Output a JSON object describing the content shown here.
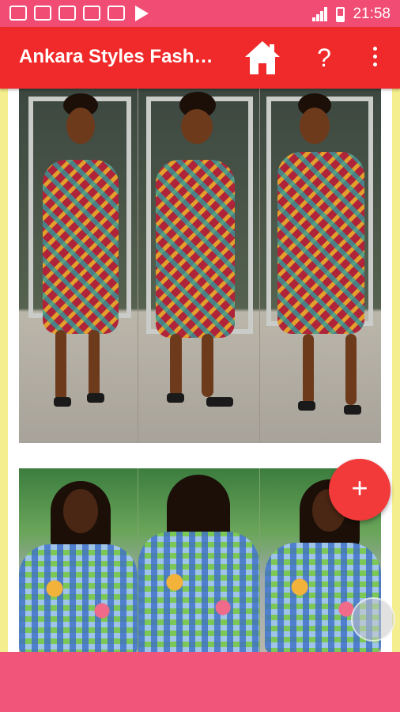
{
  "status_bar": {
    "time": "21:58",
    "notification_icons": [
      "message-icon",
      "image-icon",
      "chat-icon",
      "office-icon",
      "check-icon",
      "play-store-icon"
    ]
  },
  "app_bar": {
    "title": "Ankara Styles Fashion",
    "home_icon": "home-icon",
    "help_label": "?",
    "more_icon": "more-vert-icon"
  },
  "fab": {
    "label": "+"
  },
  "colors": {
    "status_bar": "#f04c74",
    "app_bar": "#f02a2a",
    "fab": "#f23a3a",
    "page_bg": "#f4ee8e",
    "ad_banner": "#f2557a"
  }
}
